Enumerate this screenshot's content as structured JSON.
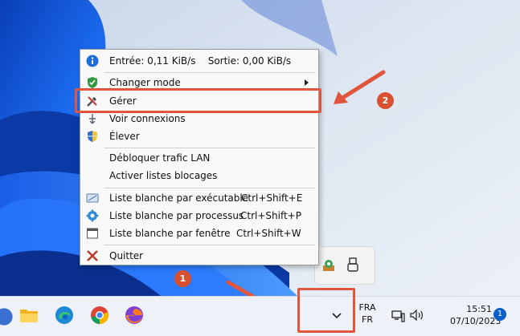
{
  "context_menu": {
    "status": "Entrée: 0,11 KiB/s    Sortie: 0,00 KiB/s",
    "items": [
      {
        "label": "Changer mode",
        "shortcut": ""
      },
      {
        "label": "Gérer",
        "shortcut": ""
      },
      {
        "label": "Voir connexions",
        "shortcut": ""
      },
      {
        "label": "Élever",
        "shortcut": ""
      },
      {
        "label": "Débloquer trafic LAN",
        "shortcut": ""
      },
      {
        "label": "Activer listes blocages",
        "shortcut": ""
      },
      {
        "label": "Liste blanche par exécutable",
        "shortcut": "Ctrl+Shift+E"
      },
      {
        "label": "Liste blanche par processus",
        "shortcut": "Ctrl+Shift+P"
      },
      {
        "label": "Liste blanche par fenêtre",
        "shortcut": "Ctrl+Shift+W"
      },
      {
        "label": "Quitter",
        "shortcut": ""
      }
    ]
  },
  "annotations": {
    "badge_1": "1",
    "badge_2": "2",
    "color": "#e0553b"
  },
  "taskbar": {
    "lang_top": "FRA",
    "lang_bottom": "FR",
    "time": "15:51",
    "date": "07/10/2023",
    "notification_count": "1",
    "apps": [
      "file-explorer-icon",
      "edge-icon",
      "chrome-icon",
      "firefox-icon"
    ]
  }
}
